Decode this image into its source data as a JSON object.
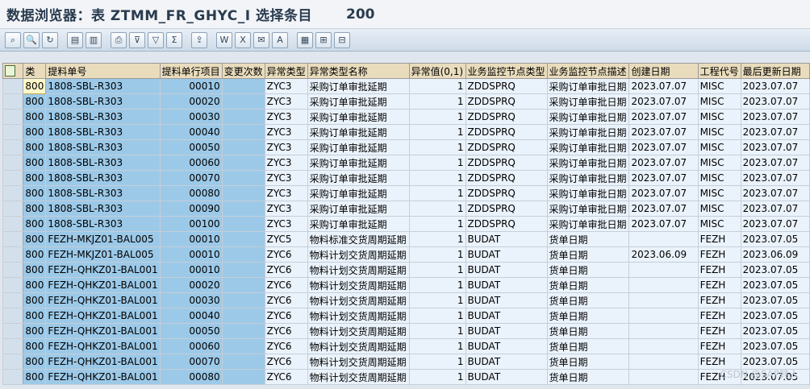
{
  "title": {
    "text": "数据浏览器：表 ZTMM_FR_GHYC_I 选择条目",
    "count": "200"
  },
  "toolbar": {
    "buttons": [
      {
        "name": "glasses-icon",
        "glyph": "⌕"
      },
      {
        "name": "detail-icon",
        "glyph": "🔍"
      },
      {
        "name": "refresh-icon",
        "glyph": "↻"
      },
      {
        "name": "sep"
      },
      {
        "name": "check-table-icon",
        "glyph": "▤"
      },
      {
        "name": "check-table-2-icon",
        "glyph": "▥"
      },
      {
        "name": "sep"
      },
      {
        "name": "print-icon",
        "glyph": "⎙"
      },
      {
        "name": "filter-icon",
        "glyph": "⊽"
      },
      {
        "name": "set-filter-icon",
        "glyph": "▽"
      },
      {
        "name": "sum-icon",
        "glyph": "Σ"
      },
      {
        "name": "sep"
      },
      {
        "name": "export-icon",
        "glyph": "⇪"
      },
      {
        "name": "sep"
      },
      {
        "name": "word-icon",
        "glyph": "W"
      },
      {
        "name": "excel-icon",
        "glyph": "X"
      },
      {
        "name": "mail-icon",
        "glyph": "✉"
      },
      {
        "name": "abc-icon",
        "glyph": "A"
      },
      {
        "name": "sep"
      },
      {
        "name": "layout-icon",
        "glyph": "▦"
      },
      {
        "name": "choose-layout-icon",
        "glyph": "⊞"
      },
      {
        "name": "save-layout-icon",
        "glyph": "⊟"
      }
    ]
  },
  "grid": {
    "headers": [
      "类",
      "提料单号",
      "提料单行项目",
      "变更次数",
      "异常类型",
      "异常类型名称",
      "异常值(0,1)",
      "业务监控节点类型",
      "业务监控节点描述",
      "创建日期",
      "工程代号",
      "最后更新日期"
    ],
    "rows": [
      [
        "800",
        "1808-SBL-R303",
        "00010",
        "",
        "ZYC3",
        "采购订单审批延期",
        "1",
        "ZDDSPRQ",
        "采购订单审批日期",
        "2023.07.07",
        "MISC",
        "2023.07.07"
      ],
      [
        "800",
        "1808-SBL-R303",
        "00020",
        "",
        "ZYC3",
        "采购订单审批延期",
        "1",
        "ZDDSPRQ",
        "采购订单审批日期",
        "2023.07.07",
        "MISC",
        "2023.07.07"
      ],
      [
        "800",
        "1808-SBL-R303",
        "00030",
        "",
        "ZYC3",
        "采购订单审批延期",
        "1",
        "ZDDSPRQ",
        "采购订单审批日期",
        "2023.07.07",
        "MISC",
        "2023.07.07"
      ],
      [
        "800",
        "1808-SBL-R303",
        "00040",
        "",
        "ZYC3",
        "采购订单审批延期",
        "1",
        "ZDDSPRQ",
        "采购订单审批日期",
        "2023.07.07",
        "MISC",
        "2023.07.07"
      ],
      [
        "800",
        "1808-SBL-R303",
        "00050",
        "",
        "ZYC3",
        "采购订单审批延期",
        "1",
        "ZDDSPRQ",
        "采购订单审批日期",
        "2023.07.07",
        "MISC",
        "2023.07.07"
      ],
      [
        "800",
        "1808-SBL-R303",
        "00060",
        "",
        "ZYC3",
        "采购订单审批延期",
        "1",
        "ZDDSPRQ",
        "采购订单审批日期",
        "2023.07.07",
        "MISC",
        "2023.07.07"
      ],
      [
        "800",
        "1808-SBL-R303",
        "00070",
        "",
        "ZYC3",
        "采购订单审批延期",
        "1",
        "ZDDSPRQ",
        "采购订单审批日期",
        "2023.07.07",
        "MISC",
        "2023.07.07"
      ],
      [
        "800",
        "1808-SBL-R303",
        "00080",
        "",
        "ZYC3",
        "采购订单审批延期",
        "1",
        "ZDDSPRQ",
        "采购订单审批日期",
        "2023.07.07",
        "MISC",
        "2023.07.07"
      ],
      [
        "800",
        "1808-SBL-R303",
        "00090",
        "",
        "ZYC3",
        "采购订单审批延期",
        "1",
        "ZDDSPRQ",
        "采购订单审批日期",
        "2023.07.07",
        "MISC",
        "2023.07.07"
      ],
      [
        "800",
        "1808-SBL-R303",
        "00100",
        "",
        "ZYC3",
        "采购订单审批延期",
        "1",
        "ZDDSPRQ",
        "采购订单审批日期",
        "2023.07.07",
        "MISC",
        "2023.07.07"
      ],
      [
        "800",
        "FEZH-MKJZ01-BAL005",
        "00010",
        "",
        "ZYC5",
        "物料标准交货周期延期",
        "1",
        "BUDAT",
        "货单日期",
        "",
        "FEZH",
        "2023.07.05"
      ],
      [
        "800",
        "FEZH-MKJZ01-BAL005",
        "00010",
        "",
        "ZYC6",
        "物料计划交货周期延期",
        "1",
        "BUDAT",
        "货单日期",
        "2023.06.09",
        "FEZH",
        "2023.06.09"
      ],
      [
        "800",
        "FEZH-QHKZ01-BAL001",
        "00010",
        "",
        "ZYC6",
        "物料计划交货周期延期",
        "1",
        "BUDAT",
        "货单日期",
        "",
        "FEZH",
        "2023.07.05"
      ],
      [
        "800",
        "FEZH-QHKZ01-BAL001",
        "00020",
        "",
        "ZYC6",
        "物料计划交货周期延期",
        "1",
        "BUDAT",
        "货单日期",
        "",
        "FEZH",
        "2023.07.05"
      ],
      [
        "800",
        "FEZH-QHKZ01-BAL001",
        "00030",
        "",
        "ZYC6",
        "物料计划交货周期延期",
        "1",
        "BUDAT",
        "货单日期",
        "",
        "FEZH",
        "2023.07.05"
      ],
      [
        "800",
        "FEZH-QHKZ01-BAL001",
        "00040",
        "",
        "ZYC6",
        "物料计划交货周期延期",
        "1",
        "BUDAT",
        "货单日期",
        "",
        "FEZH",
        "2023.07.05"
      ],
      [
        "800",
        "FEZH-QHKZ01-BAL001",
        "00050",
        "",
        "ZYC6",
        "物料计划交货周期延期",
        "1",
        "BUDAT",
        "货单日期",
        "",
        "FEZH",
        "2023.07.05"
      ],
      [
        "800",
        "FEZH-QHKZ01-BAL001",
        "00060",
        "",
        "ZYC6",
        "物料计划交货周期延期",
        "1",
        "BUDAT",
        "货单日期",
        "",
        "FEZH",
        "2023.07.05"
      ],
      [
        "800",
        "FEZH-QHKZ01-BAL001",
        "00070",
        "",
        "ZYC6",
        "物料计划交货周期延期",
        "1",
        "BUDAT",
        "货单日期",
        "",
        "FEZH",
        "2023.07.05"
      ],
      [
        "800",
        "FEZH-QHKZ01-BAL001",
        "00080",
        "",
        "ZYC6",
        "物料计划交货周期延期",
        "1",
        "BUDAT",
        "货单日期",
        "",
        "FEZH",
        "2023.07.05"
      ]
    ]
  },
  "watermark": "CSDN @SAP韩人"
}
